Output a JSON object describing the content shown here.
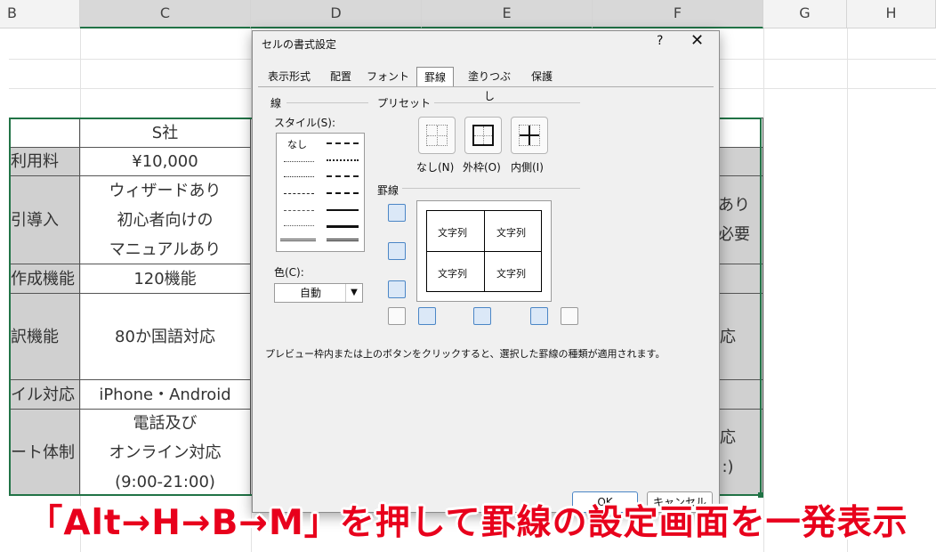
{
  "sheet": {
    "columns": [
      "B",
      "C",
      "D",
      "E",
      "F",
      "G",
      "H"
    ],
    "rows": [
      {
        "label": "利用料",
        "c": "¥10,000",
        "f": ""
      },
      {
        "label": "引導入",
        "c": "ウィザードあり\n初心者向けの\nマニュアルあり",
        "f": "あり\n必要"
      },
      {
        "label": "作成機能",
        "c": "120機能",
        "f": ""
      },
      {
        "label": "訳機能",
        "c": "80か国語対応",
        "f": "応"
      },
      {
        "label": "イル対応",
        "c": "iPhone・Android",
        "f": ""
      },
      {
        "label": "ート体制",
        "c": "電話及び\nオンライン対応\n(9:00-21:00)",
        "f": "応\n:)"
      }
    ],
    "header_row": {
      "c": "S社"
    }
  },
  "dialog": {
    "title": "セルの書式設定",
    "help": "?",
    "close": "✕",
    "tabs": [
      "表示形式",
      "配置",
      "フォント",
      "罫線",
      "塗りつぶし",
      "保護"
    ],
    "active_tab": "罫線",
    "line_group": "線",
    "style_label": "スタイル(S):",
    "style_none": "なし",
    "color_label": "色(C):",
    "color_value": "自動",
    "preset_group": "プリセット",
    "presets": [
      "なし(N)",
      "外枠(O)",
      "内側(I)"
    ],
    "border_group": "罫線",
    "preview_text": "文字列",
    "hint": "プレビュー枠内または上のボタンをクリックすると、選択した罫線の種類が適用されます。",
    "ok": "OK",
    "cancel": "キャンセル"
  },
  "caption": "「Alt→H→B→M」を押して罫線の設定画面を一発表示"
}
